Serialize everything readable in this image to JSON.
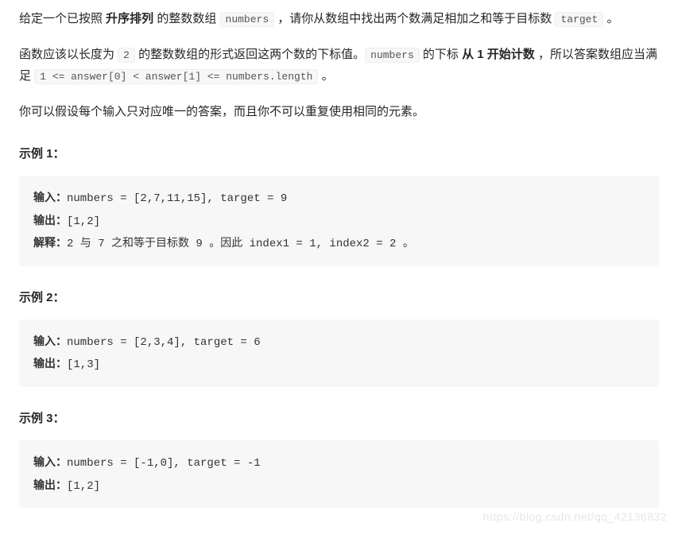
{
  "intro": {
    "p1_a": "给定一个已按照 ",
    "p1_bold1": "升序排列 ",
    "p1_b": " 的整数数组 ",
    "p1_code1": "numbers",
    "p1_c": " ，请你从数组中找出两个数满足相加之和等于目标数 ",
    "p1_code2": "target",
    "p1_d": " 。",
    "p2_a": "函数应该以长度为 ",
    "p2_code1": "2",
    "p2_b": " 的整数数组的形式返回这两个数的下标值。",
    "p2_code2": "numbers",
    "p2_c": " 的下标 ",
    "p2_bold1": "从 1 开始计数",
    "p2_d": " ，所以答案数组应当满足 ",
    "p2_code3": "1 <= answer[0] < answer[1] <= numbers.length",
    "p2_e": " 。",
    "p3": "你可以假设每个输入只对应唯一的答案，而且你不可以重复使用相同的元素。"
  },
  "labels": {
    "input": "输入：",
    "output": "输出：",
    "explain": "解释："
  },
  "examples": [
    {
      "title": "示例 1：",
      "input": "numbers = [2,7,11,15], target = 9",
      "output": "[1,2]",
      "explain": "2 与 7 之和等于目标数 9 。因此 index1 = 1, index2 = 2 。"
    },
    {
      "title": "示例 2：",
      "input": "numbers = [2,3,4], target = 6",
      "output": "[1,3]"
    },
    {
      "title": "示例 3：",
      "input": "numbers = [-1,0], target = -1",
      "output": "[1,2]"
    }
  ],
  "watermark": "https://blog.csdn.net/qq_42136832"
}
